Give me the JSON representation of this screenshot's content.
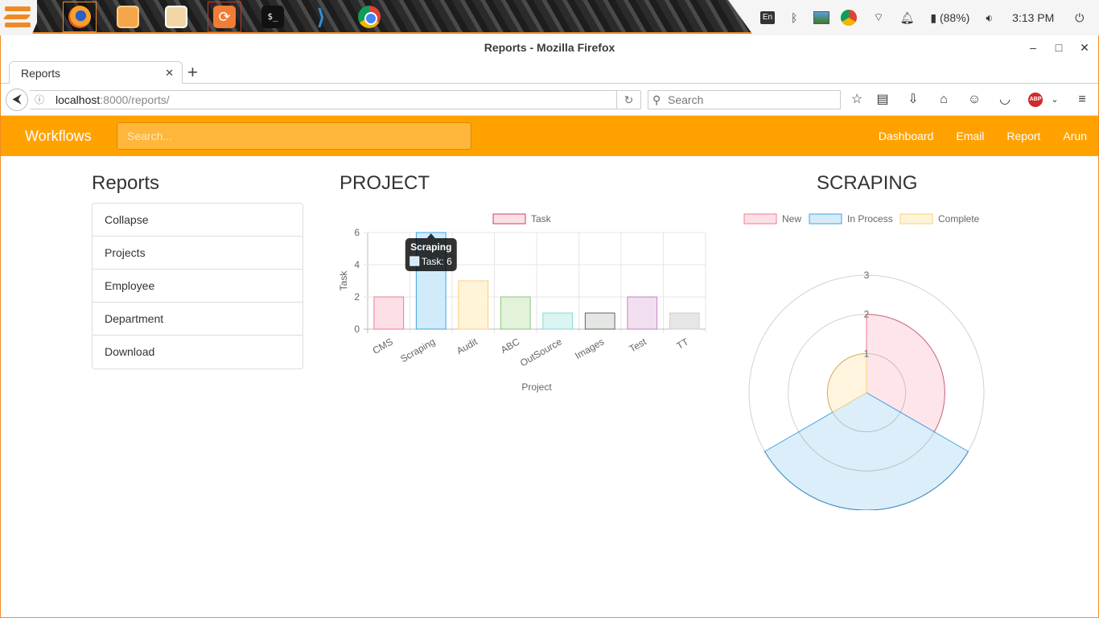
{
  "os_taskbar": {
    "apps": [
      {
        "name": "firefox-icon",
        "active": true
      },
      {
        "name": "files-icon",
        "active": false
      },
      {
        "name": "mail-icon",
        "active": false
      },
      {
        "name": "software-updater-icon",
        "active": false
      },
      {
        "name": "terminal-icon",
        "active": false
      },
      {
        "name": "vscode-icon",
        "active": false
      },
      {
        "name": "chrome-icon",
        "active": false
      }
    ],
    "keyboard_layout": "En",
    "battery": "(88%)",
    "clock": "3:13 PM"
  },
  "window": {
    "title": "Reports - Mozilla Firefox",
    "tab_title": "Reports",
    "url_host": "localhost",
    "url_rest": ":8000/reports/",
    "search_placeholder": "Search"
  },
  "app_nav": {
    "brand": "Workflows",
    "search_placeholder": "Search...",
    "links": [
      "Dashboard",
      "Email",
      "Report",
      "Arun"
    ]
  },
  "sidebar": {
    "title": "Reports",
    "items": [
      "Collapse",
      "Projects",
      "Employee",
      "Department",
      "Download"
    ]
  },
  "project_panel": {
    "title": "PROJECT"
  },
  "scraping_panel": {
    "title": "SCRAPING"
  },
  "chart_data": [
    {
      "type": "bar",
      "categories": [
        "CMS",
        "Scraping",
        "Audit",
        "ABC",
        "OutSource",
        "Images",
        "Test",
        "TT"
      ],
      "series": [
        {
          "name": "Task",
          "values": [
            2,
            6,
            3,
            2,
            1,
            1,
            2,
            1
          ]
        }
      ],
      "xlabel": "Project",
      "ylabel": "Task",
      "ylim": [
        0,
        6
      ],
      "yticks": [
        0,
        2,
        4,
        6
      ],
      "grid": true,
      "legend": "top",
      "colors": {
        "fills": [
          "#fde0e6",
          "#d2ebfb",
          "#fff3d8",
          "#e2f2db",
          "#dbf5f3",
          "#e3e6e3",
          "#f1dff0",
          "#e6e6e6"
        ],
        "strokes": [
          "#f27a95",
          "#3fa4e6",
          "#f9d27c",
          "#8cc679",
          "#7fdcd3",
          "#5d6a5d",
          "#c983c4",
          "#cfcfcf"
        ]
      },
      "tooltip": {
        "title": "Scraping",
        "label": "Task: 6",
        "category": "Scraping"
      }
    },
    {
      "type": "polarArea",
      "categories": [
        "New",
        "In Process",
        "Complete"
      ],
      "values": [
        2,
        3,
        1
      ],
      "rlim": [
        0,
        3
      ],
      "rticks": [
        1,
        2,
        3
      ],
      "legend": "top",
      "colors": {
        "fills": [
          "#fde0e6",
          "#d6ebf8",
          "#fff3d8"
        ],
        "strokes": [
          "#f27a95",
          "#3fa4e6",
          "#f9d27c"
        ]
      }
    }
  ]
}
